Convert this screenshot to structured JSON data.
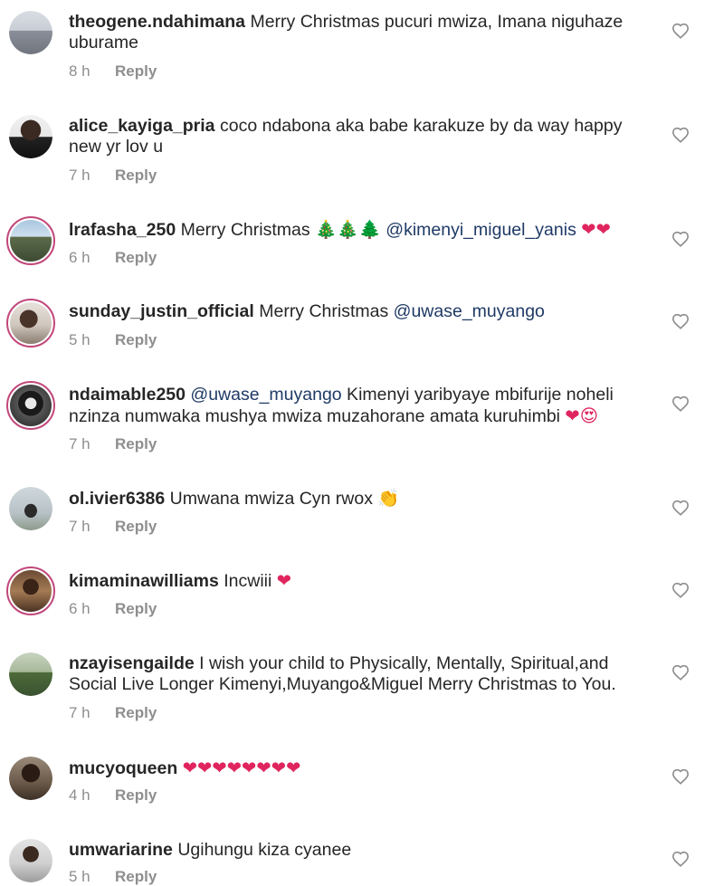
{
  "reply_label": "Reply",
  "comments": [
    {
      "username": "theogene.ndahimana",
      "text": "Merry Christmas pucuri mwiza, Imana niguhaze uburame",
      "time": "8 h"
    },
    {
      "username": "alice_kayiga_pria",
      "text": "coco ndabona aka babe  karakuze by da way happy new yr lov u",
      "time": "7 h"
    },
    {
      "username": "lrafasha_250",
      "text_before": "Merry Christmas ",
      "emoji_trees": "🎄🎄🌲",
      "mention": "@kimenyi_miguel_yanis",
      "emoji_after": "❤❤",
      "time": "6 h"
    },
    {
      "username": "sunday_justin_official",
      "text_before": "Merry Christmas ",
      "mention": "@uwase_muyango",
      "time": "5 h"
    },
    {
      "username": "ndaimable250",
      "mention": "@uwase_muyango",
      "text_after": " Kimenyi yaribyaye  mbifurije noheli nzinza numwaka mushya mwiza muzahorane amata kuruhimbi ",
      "emoji_after": "❤😍",
      "time": "7 h"
    },
    {
      "username": "ol.ivier6386",
      "text": "Umwana mwiza Cyn rwox ",
      "emoji_after": "👏",
      "time": "7 h"
    },
    {
      "username": "kimaminawilliams",
      "text": "Incwiii ",
      "emoji_after": "❤",
      "time": "6 h"
    },
    {
      "username": "nzayisengailde",
      "text": "I wish your child to Physically, Mentally, Spiritual,and Social Live Longer Kimenyi,Muyango&Miguel Merry Christmas to You.",
      "time": "7 h"
    },
    {
      "username": "mucyoqueen",
      "emoji_after": "❤❤❤❤❤❤❤❤",
      "time": "4 h"
    },
    {
      "username": "umwariarine",
      "text": "Ugihungu kiza cyanee",
      "time": "5 h"
    }
  ]
}
